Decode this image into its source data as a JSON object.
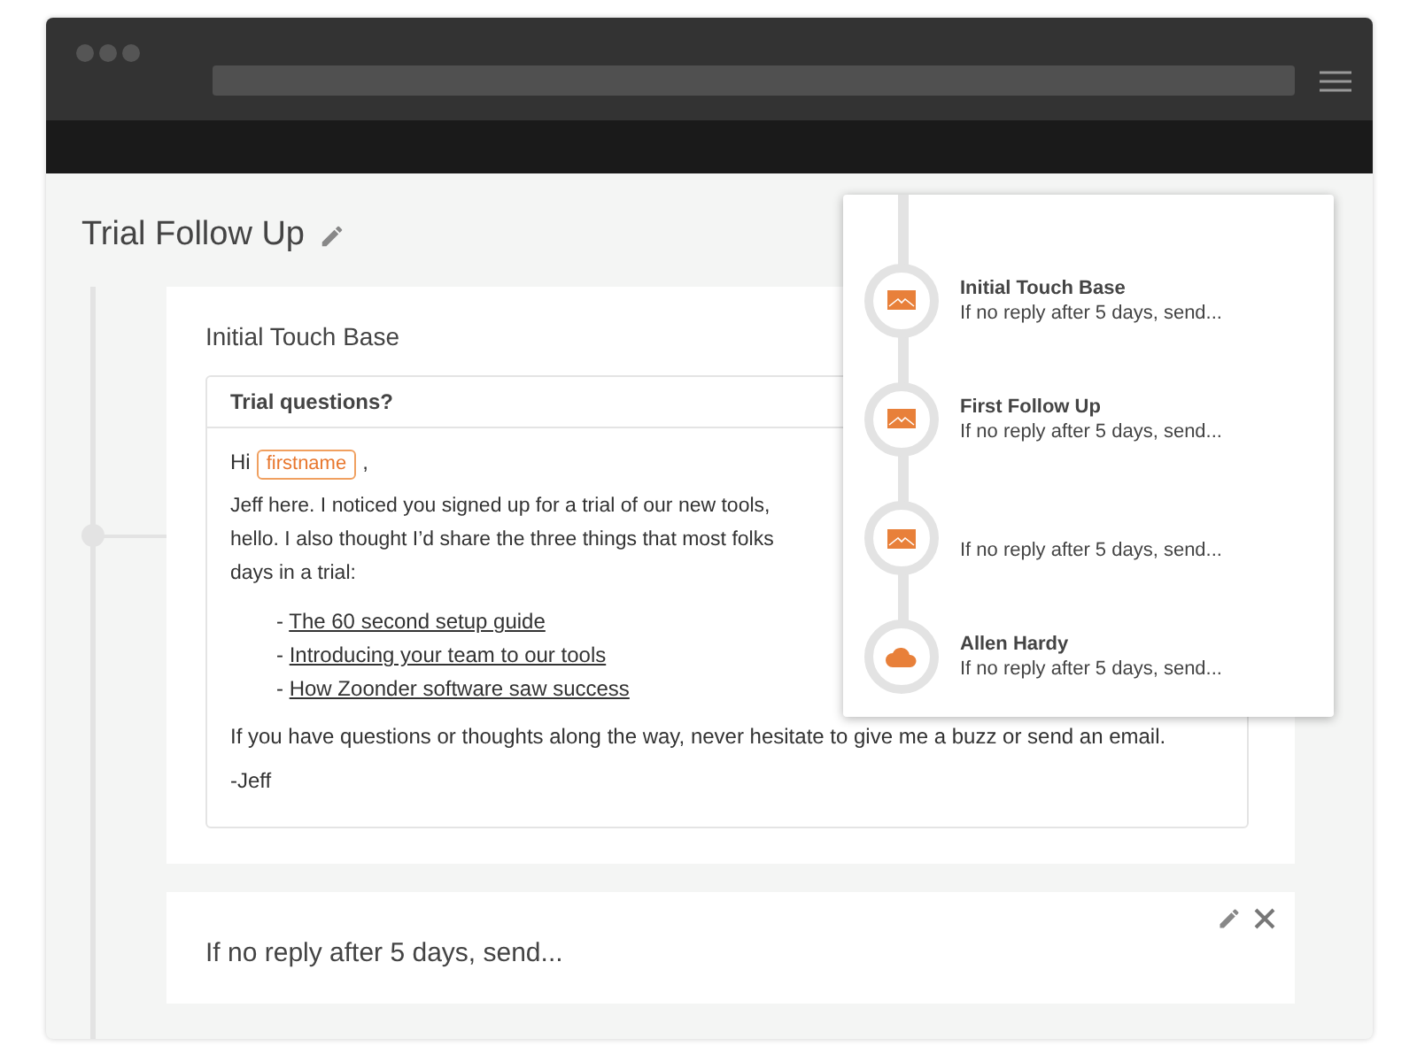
{
  "title": "Trial Follow Up",
  "steps": [
    {
      "heading": "Initial Touch Base",
      "subject": "Trial questions?",
      "greeting": "Hi",
      "token": "firstname",
      "after_token": ",",
      "intro_lines": [
        "Jeff here. I noticed you signed up for a trial of our new tools,",
        "hello. I also thought I’d share the three things that most folks",
        "days in a trial:"
      ],
      "links": [
        {
          "bullet": "-",
          "text": "The 60 second setup guide"
        },
        {
          "bullet": "-",
          "text": "Introducing your team to our tools"
        },
        {
          "bullet": "-",
          "text": "How Zoonder software saw success"
        }
      ],
      "closing": "If you have questions or thoughts along the way, never hesitate to give me a buzz or send an email.",
      "signature": "-Jeff"
    },
    {
      "heading": "If no reply after 5 days, send..."
    }
  ],
  "popup": [
    {
      "kind": "email",
      "title": "Initial Touch Base",
      "detail": "If no reply after 5 days, send..."
    },
    {
      "kind": "email",
      "title": "First Follow Up",
      "detail": "If no reply after 5 days, send..."
    },
    {
      "kind": "email",
      "detail": "If no reply after 5 days, send..."
    },
    {
      "kind": "cloud",
      "title": "Allen Hardy",
      "detail": "If no reply after 5 days, send..."
    }
  ]
}
